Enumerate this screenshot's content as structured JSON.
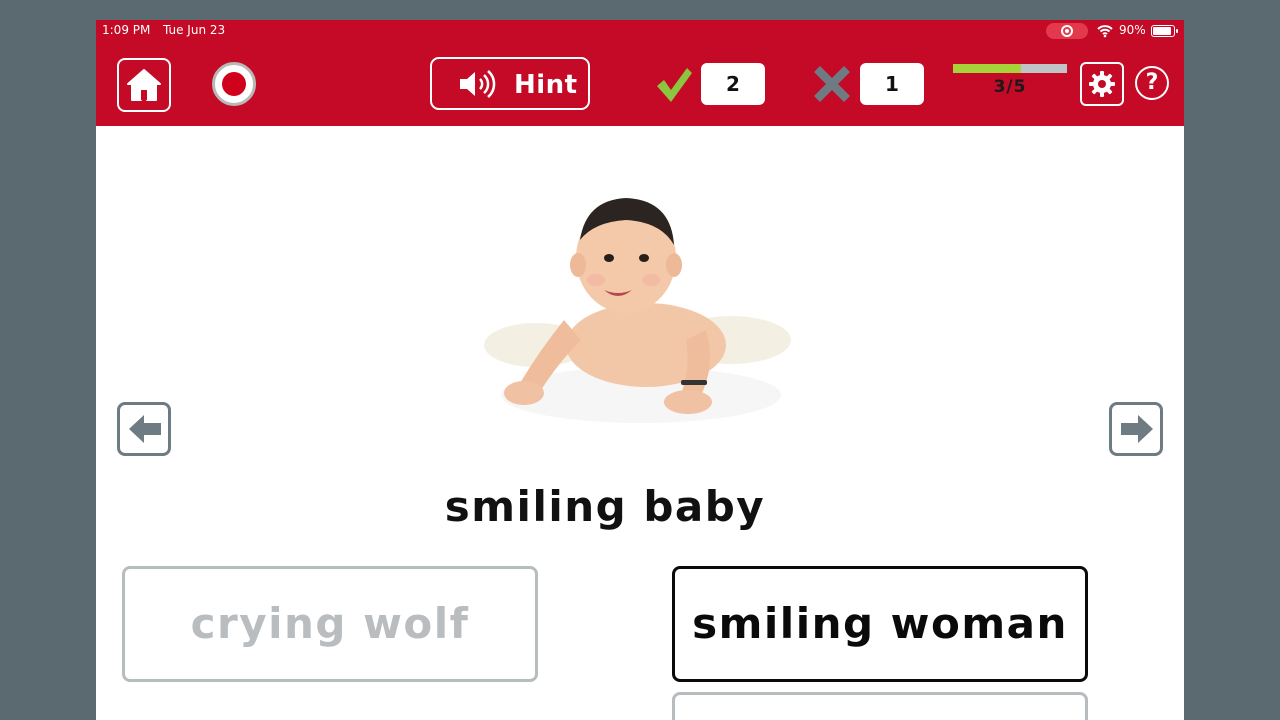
{
  "status": {
    "time": "1:09 PM",
    "date": "Tue Jun 23",
    "battery": "90%"
  },
  "toolbar": {
    "hint_label": "Hint",
    "correct_count": "2",
    "wrong_count": "1",
    "progress_text": "3/5",
    "progress_fraction": 0.6,
    "help_label": "?"
  },
  "colors": {
    "brand_red": "#c40a26",
    "check_green": "#8cc63f",
    "progress_green": "#a6d23a",
    "wrong_gray": "#6f7b83"
  },
  "icons": [
    "home-icon",
    "record-icon",
    "speaker-icon",
    "checkmark-icon",
    "x-icon",
    "gear-icon",
    "help-icon",
    "arrow-left-icon",
    "arrow-right-icon"
  ],
  "main": {
    "prompt": "smiling baby",
    "answers": [
      {
        "label": "crying wolf",
        "state": "disabled"
      },
      {
        "label": "smiling woman",
        "state": "active"
      },
      {
        "label": "",
        "state": "disabled"
      }
    ]
  }
}
